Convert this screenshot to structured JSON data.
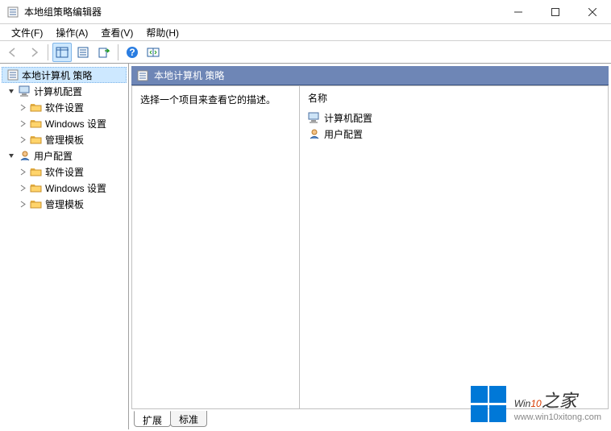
{
  "window": {
    "title": "本地组策略编辑器"
  },
  "menubar": {
    "file": "文件(F)",
    "action": "操作(A)",
    "view": "查看(V)",
    "help": "帮助(H)"
  },
  "tree": {
    "root": "本地计算机 策略",
    "computer": "计算机配置",
    "user": "用户配置",
    "software": "软件设置",
    "windows": "Windows 设置",
    "admin": "管理模板"
  },
  "content": {
    "header": "本地计算机 策略",
    "prompt": "选择一个项目来查看它的描述。",
    "col_name": "名称",
    "items": {
      "computer": "计算机配置",
      "user": "用户配置"
    }
  },
  "tabs": {
    "extended": "扩展",
    "standard": "标准"
  },
  "watermark": {
    "brand_prefix": "Win",
    "brand_accent": "10",
    "brand_suffix": "之家",
    "url": "www.win10xitong.com"
  }
}
